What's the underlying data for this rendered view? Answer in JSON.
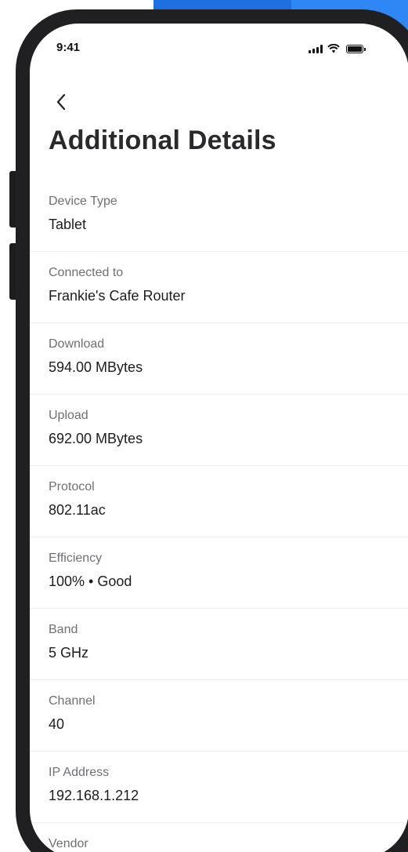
{
  "status_bar": {
    "time": "9:41",
    "icons": [
      "cellular-signal-icon",
      "wifi-icon",
      "battery-icon"
    ]
  },
  "header": {
    "back_icon": "chevron-left-icon",
    "title": "Additional Details"
  },
  "details": [
    {
      "label": "Device Type",
      "value": "Tablet"
    },
    {
      "label": "Connected to",
      "value": "Frankie's Cafe Router"
    },
    {
      "label": "Download",
      "value": "594.00 MBytes"
    },
    {
      "label": "Upload",
      "value": "692.00 MBytes"
    },
    {
      "label": "Protocol",
      "value": "802.11ac"
    },
    {
      "label": "Efficiency",
      "value": "100% • Good"
    },
    {
      "label": "Band",
      "value": "5 GHz"
    },
    {
      "label": "Channel",
      "value": "40"
    },
    {
      "label": "IP Address",
      "value": "192.168.1.212"
    },
    {
      "label": "Vendor",
      "value": ""
    }
  ],
  "colors": {
    "background_accent": "#1f6fe0",
    "phone_frame": "#202022",
    "title_text": "#2a2a2c",
    "label_text": "#6f6f74",
    "value_text": "#1c1c1e",
    "divider": "#ededee"
  }
}
